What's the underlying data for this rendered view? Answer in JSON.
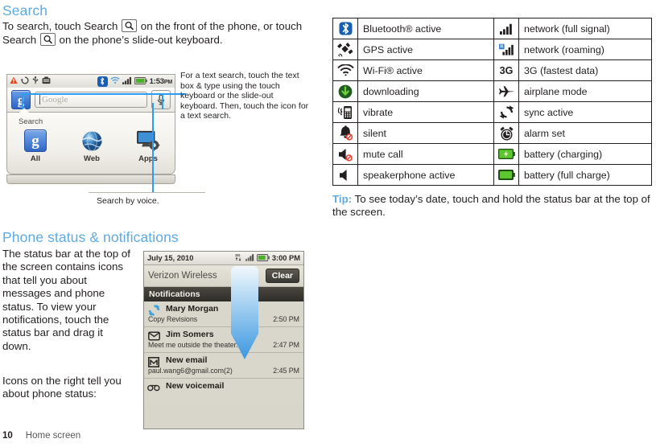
{
  "sections": {
    "search": {
      "heading": "Search",
      "intro_part1": "To search, touch Search",
      "intro_part2": "on the front of the phone, or touch Search",
      "intro_part3": "on the phone’s slide-out keyboard.",
      "callout_text": "For a text search, touch the text box & type using the touch keyboard or the slide-out keyboard. Then, touch the icon for a text search.",
      "voice_caption": "Search by voice."
    },
    "status": {
      "heading": "Phone status & notifications",
      "paragraph1": "The status bar at the top of the screen contains icons that tell you about messages and phone status. To view your notifications, touch the status bar and drag it down.",
      "paragraph2": "Icons on the right tell you about phone status:"
    }
  },
  "phone_search": {
    "status_bar": {
      "time": "1:53",
      "ampm": "PM",
      "left_icons": [
        "warning-icon",
        "sync-icon",
        "usb-icon",
        "sd-card-icon"
      ],
      "right_icons": [
        "bluetooth-icon",
        "wifi-icon",
        "signal-icon",
        "battery-icon"
      ]
    },
    "search_box": {
      "logo": "g",
      "placeholder": "Google",
      "mic_icon": "microphone-icon"
    },
    "dropdown": {
      "label": "Search",
      "items": [
        {
          "label": "All",
          "icon": "google-icon"
        },
        {
          "label": "Web",
          "icon": "globe-icon"
        },
        {
          "label": "Apps",
          "icon": "apps-icon"
        }
      ]
    }
  },
  "notification_panel": {
    "status_bar": {
      "date": "July 15, 2010",
      "time": "3:00 PM",
      "icons": [
        "3g-icon",
        "signal-icon",
        "battery-icon"
      ]
    },
    "carrier": "Verizon Wireless",
    "clear_label": "Clear",
    "header": "Notifications",
    "items": [
      {
        "icon": "sync-icon",
        "title": "Mary Morgan",
        "subtitle": "Copy Revisions",
        "time": "2:50 PM"
      },
      {
        "icon": "message-icon",
        "title": "Jim Somers",
        "subtitle": "Meet me outside the theater...",
        "time": "2:47 PM"
      },
      {
        "icon": "gmail-icon",
        "title": "New email",
        "subtitle": "paul.wang6@gmail.com(2)",
        "time": "2:45 PM"
      },
      {
        "icon": "voicemail-icon",
        "title": "New voicemail",
        "subtitle": "",
        "time": ""
      }
    ]
  },
  "icon_table": {
    "rows": [
      {
        "left_icon": "bluetooth-icon",
        "left_label": "Bluetooth® active",
        "right_icon": "signal-full-icon",
        "right_label": "network (full signal)"
      },
      {
        "left_icon": "gps-icon",
        "left_label": "GPS active",
        "right_icon": "signal-roaming-icon",
        "right_label": "network (roaming)"
      },
      {
        "left_icon": "wifi-icon",
        "left_label": "Wi-Fi® active",
        "right_icon": "3g-icon",
        "right_label": "3G (fastest data)"
      },
      {
        "left_icon": "download-icon",
        "left_label": "downloading",
        "right_icon": "airplane-icon",
        "right_label": "airplane mode"
      },
      {
        "left_icon": "vibrate-icon",
        "left_label": "vibrate",
        "right_icon": "sync-icon",
        "right_label": "sync active"
      },
      {
        "left_icon": "silent-icon",
        "left_label": "silent",
        "right_icon": "alarm-icon",
        "right_label": "alarm set"
      },
      {
        "left_icon": "mute-call-icon",
        "left_label": "mute call",
        "right_icon": "battery-charging-icon",
        "right_label": "battery (charging)"
      },
      {
        "left_icon": "speakerphone-icon",
        "left_label": "speakerphone active",
        "right_icon": "battery-full-icon",
        "right_label": "battery (full charge)"
      }
    ]
  },
  "tip": {
    "label": "Tip:",
    "text": " To see today’s date, touch and hold the status bar at the top of the screen."
  },
  "footer": {
    "page_number": "10",
    "chapter": "Home screen"
  },
  "colors": {
    "accent_blue": "#5eaae1",
    "callout_blue": "#2a9df4",
    "text": "#231f20",
    "battery_green": "#4caf2a"
  }
}
